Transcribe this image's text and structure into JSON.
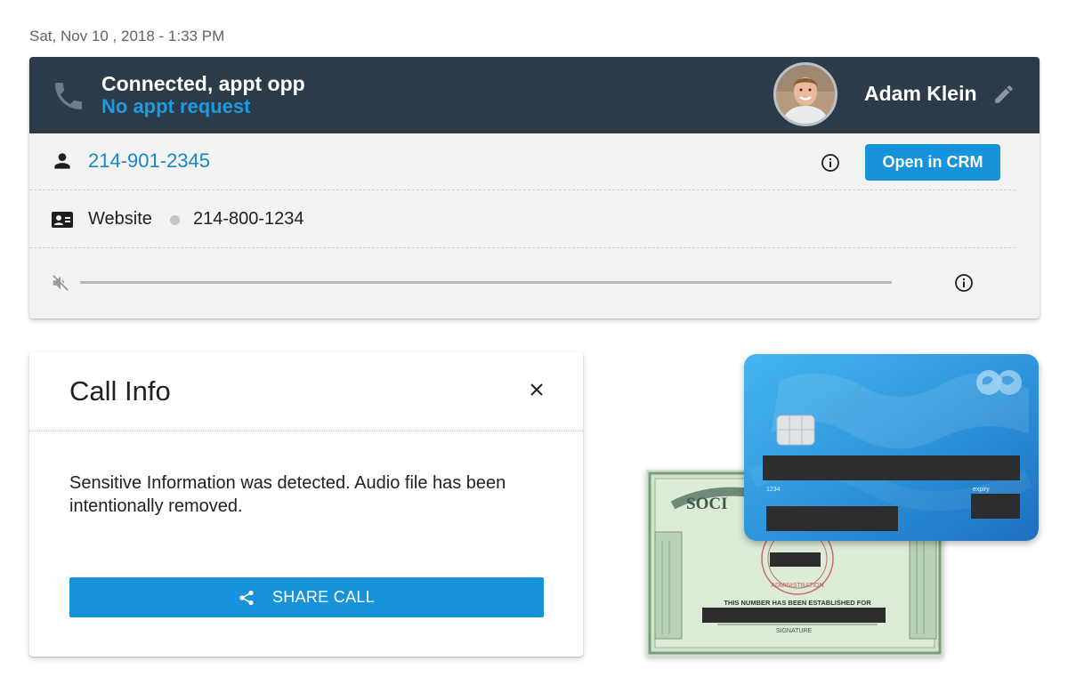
{
  "timestamp": "Sat, Nov 10 , 2018 - 1:33 PM",
  "call": {
    "status_title": "Connected, appt opp",
    "status_subtitle": "No appt request",
    "agent_name": "Adam Klein",
    "caller_phone": "214-901-2345",
    "crm_button": "Open in CRM",
    "source_label": "Website",
    "source_phone": "214-800-1234"
  },
  "call_info": {
    "title": "Call Info",
    "message": "Sensitive Information was detected. Audio file has been intentionally removed.",
    "share_button": "SHARE CALL"
  },
  "illustrations": {
    "ss_card_text": "SOCI",
    "ss_card_seal": "ADMINISTRATION",
    "ss_card_notice": "THIS NUMBER HAS BEEN ESTABLISHED FOR",
    "ss_card_signature": "SIGNATURE",
    "credit_card_number_label": "1234",
    "credit_card_expiry_label": "expiry"
  },
  "colors": {
    "header_bg": "#2c3b4a",
    "accent_blue": "#1693db",
    "link_blue": "#1a86cf",
    "status_blue": "#1e9ae0"
  },
  "icons": [
    "phone-icon",
    "edit-icon",
    "person-icon",
    "info-icon",
    "contact-card-icon",
    "mute-icon",
    "close-icon",
    "share-icon"
  ]
}
